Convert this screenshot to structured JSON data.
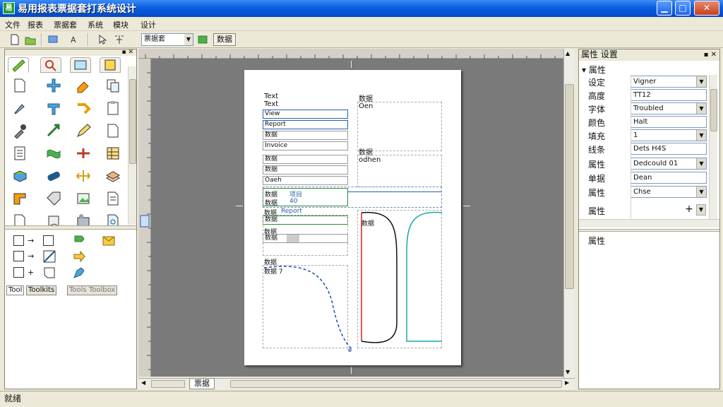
{
  "window": {
    "title": "易用报表票据套打系统设计",
    "app_icon_text": "易",
    "minimize": "▁",
    "maximize": "□",
    "close": "✕"
  },
  "menu": [
    "文件",
    "报表",
    "票据套",
    "系统",
    "模块",
    "设计"
  ],
  "toolbar": {
    "combo_value": "票据套",
    "text_button": "数据"
  },
  "left_panel": {
    "bottom_tabs": [
      "Tool",
      "Toolkits",
      "Tools Toolbox"
    ]
  },
  "page": {
    "left_col": [
      "Text",
      "Text",
      "View",
      "Report",
      "数据",
      "Invoice"
    ],
    "right_col_header": "数据",
    "right_col_sub": "Oen",
    "mid_labels": [
      "数据",
      "数据",
      "Oaeh"
    ],
    "right_mid": "数据",
    "right_mid2": "odhen",
    "green_rows": [
      {
        "label": "数据",
        "value": "项目"
      },
      {
        "label": "数据",
        "value": "40"
      }
    ],
    "blue_link": "Report",
    "section_labels": [
      "数据",
      "数据",
      "数据"
    ],
    "field_bottom": "数据",
    "chart_label": "数据",
    "chart_sub": "数据 7",
    "right_chart_label": "数据"
  },
  "bottom_tab": "票据",
  "right_panel": {
    "title": "属性 设置",
    "section": "属性",
    "rows": [
      {
        "label": "设定",
        "value": "Vigner",
        "dropdown": true
      },
      {
        "label": "高度",
        "value": "TT12",
        "dropdown": false
      },
      {
        "label": "字体",
        "value": "Troubled",
        "dropdown": true
      },
      {
        "label": "颜色",
        "value": "Halt",
        "dropdown": false
      },
      {
        "label": "填充",
        "value": "1",
        "dropdown": true
      },
      {
        "label": "线条",
        "value": "Dets H4S",
        "dropdown": false
      },
      {
        "label": "属性",
        "value": "Dedcould 01",
        "dropdown": true
      },
      {
        "label": "单据",
        "value": "Dean",
        "dropdown": false
      },
      {
        "label": "属性",
        "value": "Chse",
        "dropdown": true
      },
      {
        "label": "属性",
        "value": "",
        "dropdown": true
      }
    ],
    "bottom_label": "属性"
  },
  "status": "就绪",
  "colors": {
    "titlebar": "#0a5fe0",
    "accent_blue": "#2a5db0",
    "green_box": "#2e8b2e",
    "curve_blue": "#1f4fa8",
    "red_line": "#d62020",
    "teal_curve": "#1aa7a7"
  }
}
